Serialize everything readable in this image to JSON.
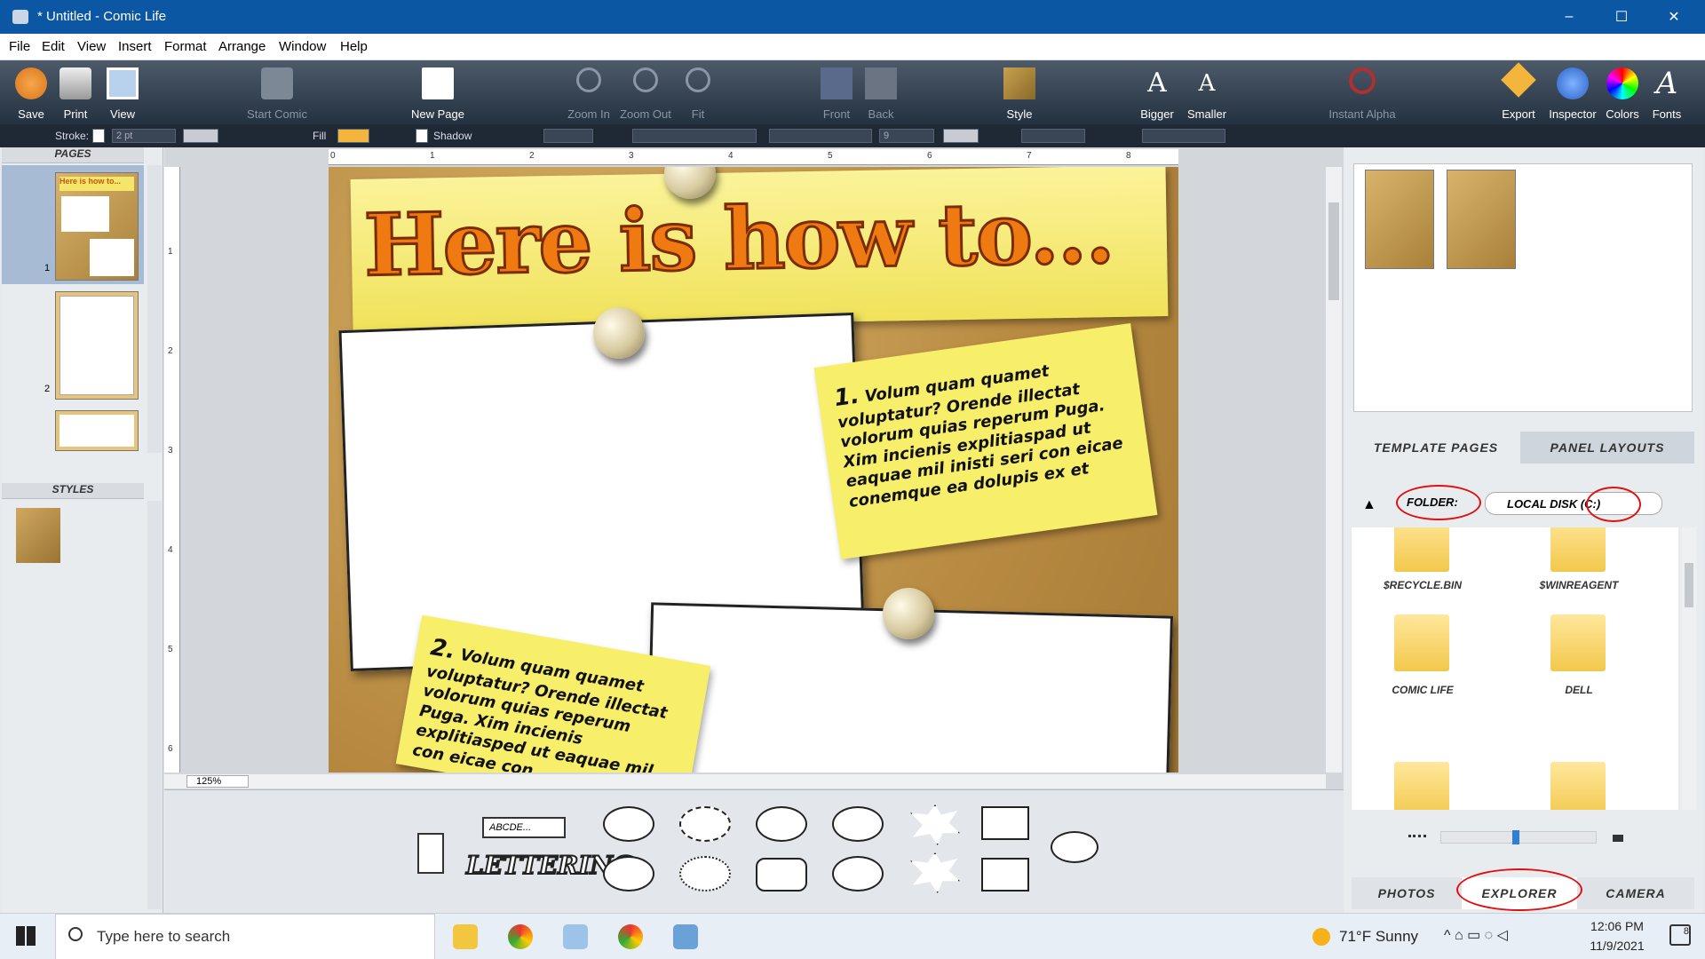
{
  "window": {
    "title": "* Untitled - Comic Life",
    "controls": [
      "–",
      "☐",
      "✕"
    ]
  },
  "menu": [
    "File",
    "Edit",
    "View",
    "Insert",
    "Format",
    "Arrange",
    "Window",
    "Help"
  ],
  "toolbar": {
    "items": [
      {
        "label": "Save",
        "icon": "save-icon"
      },
      {
        "label": "Print",
        "icon": "print-icon"
      },
      {
        "label": "View",
        "icon": "view-icon"
      },
      {
        "label": "Start Comic",
        "icon": "start-comic-icon"
      },
      {
        "label": "New Page",
        "icon": "new-page-icon"
      },
      {
        "label": "Zoom In",
        "icon": "zoom-in-icon"
      },
      {
        "label": "Zoom Out",
        "icon": "zoom-out-icon"
      },
      {
        "label": "Fit",
        "icon": "fit-icon"
      },
      {
        "label": "Front",
        "icon": "front-icon"
      },
      {
        "label": "Back",
        "icon": "back-icon"
      },
      {
        "label": "Style",
        "icon": "style-icon"
      },
      {
        "label": "Bigger",
        "icon": "bigger-icon"
      },
      {
        "label": "Smaller",
        "icon": "smaller-icon"
      },
      {
        "label": "Instant Alpha",
        "icon": "instant-alpha-icon"
      },
      {
        "label": "Export",
        "icon": "export-icon"
      },
      {
        "label": "Inspector",
        "icon": "inspector-icon"
      },
      {
        "label": "Colors",
        "icon": "colors-icon"
      },
      {
        "label": "Fonts",
        "icon": "fonts-icon"
      }
    ]
  },
  "format": {
    "stroke_label": "Stroke:",
    "stroke_value": "2 pt",
    "fill_label": "Fill",
    "shadow_label": "Shadow",
    "font_size": "9",
    "fill_color": "#f3b53c"
  },
  "pages_panel": {
    "header": "PAGES",
    "pages": [
      "1",
      "2"
    ],
    "thumb_title": "Here is how to...",
    "styles_header": "STYLES"
  },
  "ruler": {
    "h": [
      "0",
      "1",
      "2",
      "3",
      "4",
      "5",
      "6",
      "7",
      "8"
    ],
    "v": [
      "1",
      "2",
      "3",
      "4",
      "5",
      "6"
    ]
  },
  "comic": {
    "title": "Here is how to...",
    "note1_num": "1.",
    "note1": "Volum quam quamet voluptatur? Orende illectat volorum quias reperum Puga. Xim incienis explitiaspad ut eaquae mil inisti seri con eicae conemque ea dolupis ex et",
    "note2_num": "2.",
    "note2": "Volum quam quamet voluptatur? Orende illectat volorum quias reperum Puga. Xim incienis explitiasped ut eaquae mil con eicae con"
  },
  "zoom": "125%",
  "lettering": {
    "caption": "ABCDE...",
    "art": "LETTERING"
  },
  "right_panel": {
    "tabs": [
      "TEMPLATE PAGES",
      "PANEL LAYOUTS"
    ],
    "folder_label": "FOLDER:",
    "folder_value": "LOCAL DISK (C:)",
    "folders": [
      "$RECYCLE.BIN",
      "$WINREAGENT",
      "COMIC LIFE",
      "DELL",
      "",
      ""
    ],
    "bottom_tabs": [
      "PHOTOS",
      "EXPLORER",
      "CAMERA"
    ]
  },
  "taskbar": {
    "search_placeholder": "Type here to search",
    "weather": "71°F  Sunny",
    "time": "12:06 PM",
    "date": "11/9/2021",
    "notifications": "8"
  }
}
